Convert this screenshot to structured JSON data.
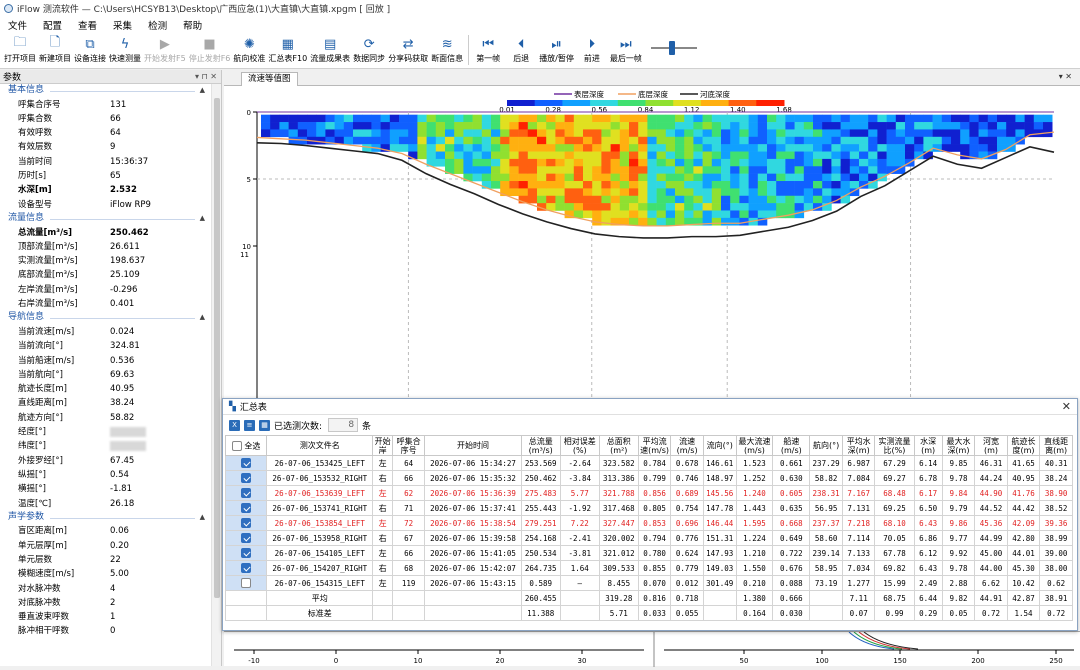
{
  "window": {
    "title": "iFlow 测流软件 — C:\\Users\\HCSYB13\\Desktop\\广西应急(1)\\大直镇\\大直镇.xpgm [ 回放 ]"
  },
  "menu": [
    "文件",
    "配置",
    "查看",
    "采集",
    "检测",
    "帮助"
  ],
  "toolbar": [
    {
      "label": "打开项目",
      "icon": "folder-icon",
      "glyph": "🗀",
      "enabled": true
    },
    {
      "label": "新建项目",
      "icon": "new-file-icon",
      "glyph": "🗋",
      "enabled": true
    },
    {
      "label": "设备连接",
      "icon": "device-connect-icon",
      "glyph": "⧉",
      "enabled": true
    },
    {
      "label": "快速测量",
      "icon": "lightning-icon",
      "glyph": "ϟ",
      "enabled": true
    },
    {
      "label": "开始发射F5",
      "icon": "play-icon",
      "glyph": "▶",
      "enabled": false
    },
    {
      "label": "停止发射F6",
      "icon": "stop-icon",
      "glyph": "■",
      "enabled": false
    },
    {
      "label": "航向校准",
      "icon": "helm-icon",
      "glyph": "✺",
      "enabled": true
    },
    {
      "label": "汇总表F10",
      "icon": "summary-grid-icon",
      "glyph": "▦",
      "enabled": true
    },
    {
      "label": "流量成果表",
      "icon": "table-icon",
      "glyph": "▤",
      "enabled": true
    },
    {
      "label": "数据同步",
      "icon": "sync-icon",
      "glyph": "⟳",
      "enabled": true
    },
    {
      "label": "分享码获取",
      "icon": "share-icon",
      "glyph": "⇄",
      "enabled": true
    },
    {
      "label": "断面信息",
      "icon": "cross-section-icon",
      "glyph": "≋",
      "enabled": true
    },
    {
      "label": "第一帧",
      "icon": "first-frame-icon",
      "glyph": "⏮",
      "enabled": true
    },
    {
      "label": "后退",
      "icon": "step-back-icon",
      "glyph": "⏴",
      "enabled": true
    },
    {
      "label": "播放/暂停",
      "icon": "play-pause-icon",
      "glyph": "⏯",
      "enabled": true
    },
    {
      "label": "前进",
      "icon": "step-forward-icon",
      "glyph": "⏵",
      "enabled": true
    },
    {
      "label": "最后一帧",
      "icon": "last-frame-icon",
      "glyph": "⏭",
      "enabled": true
    }
  ],
  "panel": {
    "title": "参数",
    "sections": [
      {
        "title": "基本信息",
        "rows": [
          {
            "k": "呼集合序号",
            "v": "131"
          },
          {
            "k": "呼集合数",
            "v": "66"
          },
          {
            "k": "有效呼数",
            "v": "64"
          },
          {
            "k": "有效层数",
            "v": "9"
          },
          {
            "k": "当前时间",
            "v": "15:36:37"
          },
          {
            "k": "历时[s]",
            "v": "65"
          },
          {
            "k": "水深[m]",
            "v": "2.532",
            "bold": true
          },
          {
            "k": "设备型号",
            "v": "iFlow RP9"
          }
        ]
      },
      {
        "title": "流量信息",
        "rows": [
          {
            "k": "总流量[m³/s]",
            "v": "250.462",
            "bold": true
          },
          {
            "k": "顶部流量[m³/s]",
            "v": "26.611"
          },
          {
            "k": "实测流量[m³/s]",
            "v": "198.637"
          },
          {
            "k": "底部流量[m³/s]",
            "v": "25.109"
          },
          {
            "k": "左岸流量[m³/s]",
            "v": "-0.296"
          },
          {
            "k": "右岸流量[m³/s]",
            "v": "0.401"
          }
        ]
      },
      {
        "title": "导航信息",
        "rows": [
          {
            "k": "当前流速[m/s]",
            "v": "0.024"
          },
          {
            "k": "当前流向[°]",
            "v": "324.81"
          },
          {
            "k": "当前船速[m/s]",
            "v": "0.536"
          },
          {
            "k": "当前航向[°]",
            "v": "69.63"
          },
          {
            "k": "航迹长度[m]",
            "v": "40.95"
          },
          {
            "k": "直线距离[m]",
            "v": "38.24"
          },
          {
            "k": "航迹方向[°]",
            "v": "58.82"
          },
          {
            "k": "经度[°]",
            "v": ""
          },
          {
            "k": "纬度[°]",
            "v": ""
          },
          {
            "k": "外接罗经[°]",
            "v": "67.45"
          },
          {
            "k": "纵摇[°]",
            "v": "0.54"
          },
          {
            "k": "横摇[°]",
            "v": "-1.81"
          },
          {
            "k": "温度[℃]",
            "v": "26.18"
          }
        ]
      },
      {
        "title": "声学参数",
        "rows": [
          {
            "k": "盲区距离[m]",
            "v": "0.06"
          },
          {
            "k": "单元层厚[m]",
            "v": "0.20"
          },
          {
            "k": "单元层数",
            "v": "22"
          },
          {
            "k": "模糊速度[m/s]",
            "v": "5.00"
          },
          {
            "k": "对水脉冲数",
            "v": "4"
          },
          {
            "k": "对底脉冲数",
            "v": "2"
          },
          {
            "k": "垂直波束呼数",
            "v": "1"
          },
          {
            "k": "脉冲相干呼数",
            "v": "0"
          }
        ]
      }
    ]
  },
  "chart_tab": "流速等值图",
  "chart_data": {
    "type": "heatmap",
    "title": "",
    "colorbar_ticks": [
      "0.01",
      "0.28",
      "0.56",
      "0.84",
      "1.12",
      "1.40",
      "1.68"
    ],
    "colorbar_range": [
      0.01,
      1.68
    ],
    "legend": [
      "表层深度",
      "底层深度",
      "河底深度"
    ],
    "legend_colors": [
      "#7030a0",
      "#f0a060",
      "#222222"
    ],
    "yticks": [
      "0",
      "5",
      "10"
    ],
    "ylim": [
      0,
      10.5
    ],
    "riverbed_depth": [
      2.3,
      2.35,
      2.5,
      2.7,
      2.9,
      3.1,
      3.6,
      4.6,
      5.4,
      6.1,
      6.9,
      7.6,
      8.2,
      8.7,
      9.1,
      9.3,
      9.4,
      9.4,
      9.3,
      9.3,
      9.2,
      8.9,
      8.6,
      8.1,
      7.4,
      6.3,
      5.5,
      4.4,
      3.3,
      3.9,
      4.2,
      3.4,
      2.6,
      3.0
    ],
    "bottom_layer_depth": [
      1.9,
      2.0,
      2.1,
      2.3,
      2.5,
      2.7,
      3.1,
      3.9,
      4.6,
      5.3,
      6.0,
      6.7,
      7.3,
      7.8,
      8.2,
      8.4,
      8.5,
      8.5,
      8.4,
      8.3,
      8.3,
      8.0,
      7.7,
      7.3,
      6.6,
      5.6,
      4.8,
      3.8,
      2.7,
      3.2,
      3.5,
      2.8,
      1.7,
      1.5
    ]
  },
  "bottom_chart": {
    "xticks": [
      "-10",
      "0",
      "10",
      "20",
      "30"
    ],
    "xticks2": [
      "50",
      "100",
      "150",
      "200",
      "250"
    ]
  },
  "summary": {
    "title": "汇总表",
    "selected_label": "已选测次数:",
    "selected_count": "8",
    "selected_unit": "条",
    "columns": [
      "全选",
      "测次文件名",
      "开始岸",
      "呼集合序号",
      "开始时间",
      "总流量(m³/s)",
      "相对误差(%)",
      "总面积(m²)",
      "平均流速(m/s)",
      "流速(m/s)",
      "流向(°)",
      "最大流速(m/s)",
      "船速(m/s)",
      "航向(°)",
      "平均水深(m)",
      "实测流量比(%)",
      "水深(m)",
      "最大水深(m)",
      "河宽(m)",
      "航迹长度(m)",
      "直线距离(m)"
    ],
    "rows": [
      {
        "checked": true,
        "red": false,
        "cells": [
          "26-07-06_153425_LEFT",
          "左",
          "64",
          "2026-07-06 15:34:27",
          "253.569",
          "-2.64",
          "323.582",
          "0.784",
          "0.678",
          "146.61",
          "1.523",
          "0.661",
          "237.29",
          "6.987",
          "67.29",
          "6.14",
          "9.85",
          "46.31",
          "41.65",
          "40.31"
        ]
      },
      {
        "checked": true,
        "red": false,
        "cells": [
          "26-07-06_153532_RIGHT",
          "右",
          "66",
          "2026-07-06 15:35:32",
          "250.462",
          "-3.84",
          "313.386",
          "0.799",
          "0.746",
          "148.97",
          "1.252",
          "0.630",
          "58.82",
          "7.084",
          "69.27",
          "6.78",
          "9.78",
          "44.24",
          "40.95",
          "38.24"
        ]
      },
      {
        "checked": true,
        "red": true,
        "cells": [
          "26-07-06_153639_LEFT",
          "左",
          "62",
          "2026-07-06 15:36:39",
          "275.483",
          "5.77",
          "321.788",
          "0.856",
          "0.689",
          "145.56",
          "1.240",
          "0.605",
          "238.31",
          "7.167",
          "68.48",
          "6.17",
          "9.84",
          "44.90",
          "41.76",
          "38.90"
        ]
      },
      {
        "checked": true,
        "red": false,
        "cells": [
          "26-07-06_153741_RIGHT",
          "右",
          "71",
          "2026-07-06 15:37:41",
          "255.443",
          "-1.92",
          "317.468",
          "0.805",
          "0.754",
          "147.78",
          "1.443",
          "0.635",
          "56.95",
          "7.131",
          "69.25",
          "6.50",
          "9.79",
          "44.52",
          "44.42",
          "38.52"
        ]
      },
      {
        "checked": true,
        "red": true,
        "cells": [
          "26-07-06_153854_LEFT",
          "左",
          "72",
          "2026-07-06 15:38:54",
          "279.251",
          "7.22",
          "327.447",
          "0.853",
          "0.696",
          "146.44",
          "1.595",
          "0.668",
          "237.37",
          "7.218",
          "68.10",
          "6.43",
          "9.86",
          "45.36",
          "42.09",
          "39.36"
        ]
      },
      {
        "checked": true,
        "red": false,
        "cells": [
          "26-07-06_153958_RIGHT",
          "右",
          "67",
          "2026-07-06 15:39:58",
          "254.168",
          "-2.41",
          "320.002",
          "0.794",
          "0.776",
          "151.31",
          "1.224",
          "0.649",
          "58.60",
          "7.114",
          "70.05",
          "6.86",
          "9.77",
          "44.99",
          "42.80",
          "38.99"
        ]
      },
      {
        "checked": true,
        "red": false,
        "cells": [
          "26-07-06_154105_LEFT",
          "左",
          "66",
          "2026-07-06 15:41:05",
          "250.534",
          "-3.81",
          "321.012",
          "0.780",
          "0.624",
          "147.93",
          "1.210",
          "0.722",
          "239.14",
          "7.133",
          "67.78",
          "6.12",
          "9.92",
          "45.00",
          "44.01",
          "39.00"
        ]
      },
      {
        "checked": true,
        "red": false,
        "cells": [
          "26-07-06_154207_RIGHT",
          "右",
          "68",
          "2026-07-06 15:42:07",
          "264.735",
          "1.64",
          "309.533",
          "0.855",
          "0.779",
          "149.03",
          "1.550",
          "0.676",
          "58.95",
          "7.034",
          "69.82",
          "6.43",
          "9.78",
          "44.00",
          "45.30",
          "38.00"
        ]
      },
      {
        "checked": false,
        "red": false,
        "cells": [
          "26-07-06_154315_LEFT",
          "左",
          "119",
          "2026-07-06 15:43:15",
          "0.589",
          "—",
          "8.455",
          "0.070",
          "0.012",
          "301.49",
          "0.210",
          "0.088",
          "73.19",
          "1.277",
          "15.99",
          "2.49",
          "2.88",
          "6.62",
          "10.42",
          "0.62"
        ]
      }
    ],
    "avg": {
      "label": "平均",
      "cells": [
        "260.455",
        "",
        "319.28",
        "0.816",
        "0.718",
        "",
        "1.380",
        "0.666",
        "",
        "7.11",
        "68.75",
        "6.44",
        "9.82",
        "44.91",
        "42.87",
        "38.91"
      ]
    },
    "std": {
      "label": "标准差",
      "cells": [
        "11.388",
        "",
        "5.71",
        "0.033",
        "0.055",
        "",
        "0.164",
        "0.030",
        "",
        "0.07",
        "0.99",
        "0.29",
        "0.05",
        "0.72",
        "1.54",
        "0.72"
      ]
    }
  }
}
